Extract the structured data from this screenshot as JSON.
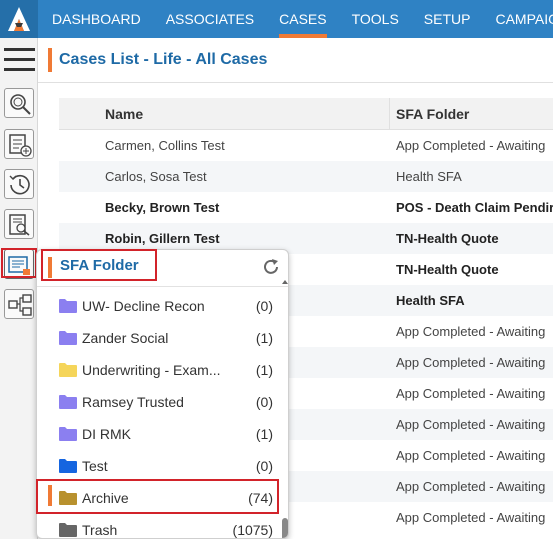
{
  "nav": {
    "logo_icon": "app-logo-icon",
    "items": [
      {
        "label": "DASHBOARD",
        "active": false
      },
      {
        "label": "ASSOCIATES",
        "active": false
      },
      {
        "label": "CASES",
        "active": true
      },
      {
        "label": "TOOLS",
        "active": false
      },
      {
        "label": "SETUP",
        "active": false
      },
      {
        "label": "CAMPAIGN",
        "active": false
      }
    ]
  },
  "sidebar": {
    "icons": [
      "hamburger-icon",
      "search-case-icon",
      "add-case-icon",
      "history-icon",
      "document-search-icon",
      "sfa-folder-icon",
      "workflow-icon"
    ]
  },
  "page": {
    "title": "Cases List - Life - All Cases"
  },
  "table": {
    "columns": [
      "Name",
      "SFA Folder"
    ],
    "rows": [
      {
        "name": "Carmen, Collins Test",
        "folder": "App Completed - Awaiting",
        "bold": false
      },
      {
        "name": "Carlos, Sosa Test",
        "folder": "Health SFA",
        "bold": false
      },
      {
        "name": "Becky, Brown Test",
        "folder": "POS - Death Claim Pendir",
        "bold": true
      },
      {
        "name": "Robin, Gillern Test",
        "folder": "TN-Health Quote",
        "bold": true
      },
      {
        "name": "",
        "folder": "TN-Health Quote",
        "bold": true
      },
      {
        "name": "",
        "folder": "Health SFA",
        "bold": true
      },
      {
        "name": "",
        "folder": "App Completed - Awaiting",
        "bold": false
      },
      {
        "name": "",
        "folder": "App Completed - Awaiting",
        "bold": false
      },
      {
        "name": "",
        "folder": "App Completed - Awaiting",
        "bold": false
      },
      {
        "name": "",
        "folder": "App Completed - Awaiting",
        "bold": false
      },
      {
        "name": "",
        "folder": "App Completed - Awaiting",
        "bold": false
      },
      {
        "name": "",
        "folder": "App Completed - Awaiting",
        "bold": false
      },
      {
        "name": "",
        "folder": "App Completed - Awaiting",
        "bold": false
      }
    ]
  },
  "sfa_popup": {
    "title": "SFA Folder",
    "refresh_icon": "refresh-icon",
    "folders": [
      {
        "label": "UW- Decline Recon",
        "count": "(0)",
        "color": "#8b7ff0"
      },
      {
        "label": "Zander Social",
        "count": "(1)",
        "color": "#8b7ff0"
      },
      {
        "label": "Underwriting - Exam...",
        "count": "(1)",
        "color": "#f5d55a"
      },
      {
        "label": "Ramsey Trusted",
        "count": "(0)",
        "color": "#8b7ff0"
      },
      {
        "label": "DI RMK",
        "count": "(1)",
        "color": "#8b7ff0"
      },
      {
        "label": "Test",
        "count": "(0)",
        "color": "#1565e0"
      },
      {
        "label": "Archive",
        "count": "(74)",
        "color": "#b8912e"
      },
      {
        "label": "Trash",
        "count": "(1075)",
        "color": "#666666"
      }
    ]
  },
  "colors": {
    "topbar": "#2f82c4",
    "accent": "#f07a35",
    "title_blue": "#1e6aa6",
    "highlight": "#d2232a"
  }
}
